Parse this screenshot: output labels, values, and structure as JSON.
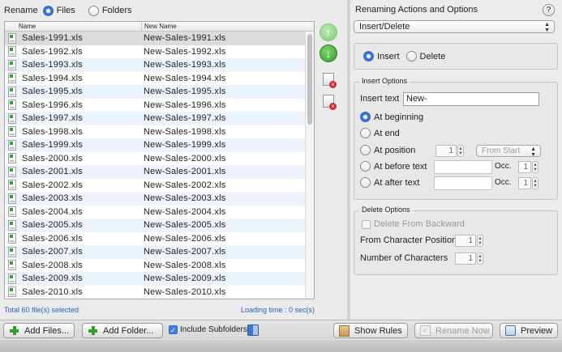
{
  "mode": {
    "title": "Rename",
    "files_label": "Files",
    "folders_label": "Folders",
    "selected": "Files"
  },
  "table": {
    "col_name": "Name",
    "col_new_name": "New Name",
    "rows": [
      {
        "name": "Sales-1991.xls",
        "new": "New-Sales-1991.xls"
      },
      {
        "name": "Sales-1992.xls",
        "new": "New-Sales-1992.xls"
      },
      {
        "name": "Sales-1993.xls",
        "new": "New-Sales-1993.xls"
      },
      {
        "name": "Sales-1994.xls",
        "new": "New-Sales-1994.xls"
      },
      {
        "name": "Sales-1995.xls",
        "new": "New-Sales-1995.xls"
      },
      {
        "name": "Sales-1996.xls",
        "new": "New-Sales-1996.xls"
      },
      {
        "name": "Sales-1997.xls",
        "new": "New-Sales-1997.xls"
      },
      {
        "name": "Sales-1998.xls",
        "new": "New-Sales-1998.xls"
      },
      {
        "name": "Sales-1999.xls",
        "new": "New-Sales-1999.xls"
      },
      {
        "name": "Sales-2000.xls",
        "new": "New-Sales-2000.xls"
      },
      {
        "name": "Sales-2001.xls",
        "new": "New-Sales-2001.xls"
      },
      {
        "name": "Sales-2002.xls",
        "new": "New-Sales-2002.xls"
      },
      {
        "name": "Sales-2003.xls",
        "new": "New-Sales-2003.xls"
      },
      {
        "name": "Sales-2004.xls",
        "new": "New-Sales-2004.xls"
      },
      {
        "name": "Sales-2005.xls",
        "new": "New-Sales-2005.xls"
      },
      {
        "name": "Sales-2006.xls",
        "new": "New-Sales-2006.xls"
      },
      {
        "name": "Sales-2007.xls",
        "new": "New-Sales-2007.xls"
      },
      {
        "name": "Sales-2008.xls",
        "new": "New-Sales-2008.xls"
      },
      {
        "name": "Sales-2009.xls",
        "new": "New-Sales-2009.xls"
      },
      {
        "name": "Sales-2010.xls",
        "new": "New-Sales-2010.xls"
      }
    ]
  },
  "status": {
    "total": "Total 60 file(s) selected",
    "loading": "Loading time : 0 sec(s)"
  },
  "options": {
    "title": "Renaming Actions and Options",
    "help": "?",
    "action_select": "Insert/Delete",
    "insert_label": "Insert",
    "delete_label": "Delete",
    "insert_group": "Insert Options",
    "insert_text_label": "Insert text",
    "insert_text_value": "New-",
    "at_beginning": "At beginning",
    "at_end": "At end",
    "at_position": "At position",
    "position_value": "1",
    "position_from": "From Start",
    "at_before_text": "At before text",
    "at_after_text": "At after text",
    "occ_label": "Occ.",
    "occ_value": "1",
    "delete_group": "Delete Options",
    "delete_from_backward": "Delete From Backward",
    "from_char_position": "From Character Position",
    "from_char_value": "1",
    "num_chars": "Number of Characters",
    "num_chars_value": "1"
  },
  "bottom": {
    "add_files": "Add Files...",
    "add_folder": "Add Folder...",
    "include_subfolders": "Include Subfolders",
    "show_rules": "Show Rules",
    "rename_now": "Rename Now",
    "preview": "Preview"
  }
}
